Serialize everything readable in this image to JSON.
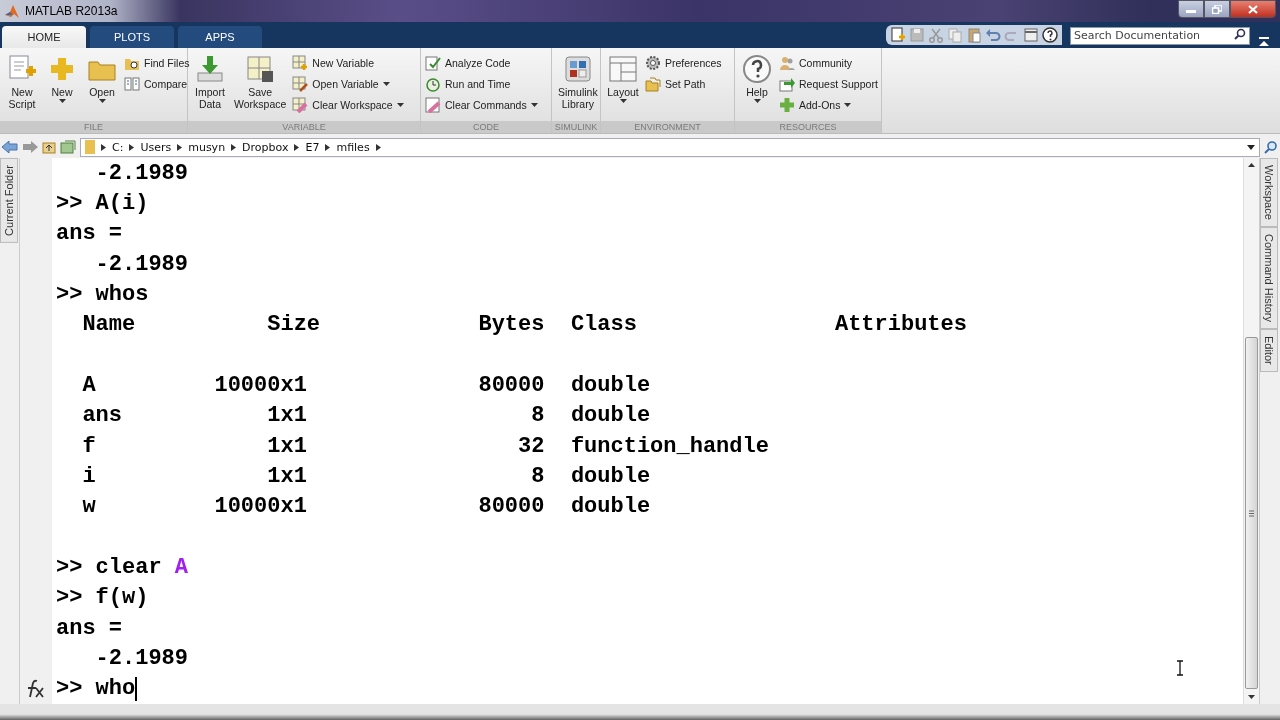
{
  "window": {
    "title": "MATLAB R2013a"
  },
  "tabs": [
    {
      "label": "HOME",
      "selected": true
    },
    {
      "label": "PLOTS",
      "selected": false
    },
    {
      "label": "APPS",
      "selected": false
    }
  ],
  "search": {
    "placeholder": "Search Documentation"
  },
  "toolstrip": {
    "sections": [
      {
        "label": "FILE",
        "items": [
          {
            "kind": "large",
            "label": "New\nScript",
            "dropdown": false
          },
          {
            "kind": "large",
            "label": "New",
            "dropdown": true
          },
          {
            "kind": "large",
            "label": "Open",
            "dropdown": true
          },
          {
            "kind": "stack",
            "items": [
              {
                "label": "Find Files",
                "dropdown": false
              },
              {
                "label": "Compare",
                "dropdown": false
              }
            ]
          }
        ]
      },
      {
        "label": "VARIABLE",
        "items": [
          {
            "kind": "large",
            "label": "Import\nData",
            "dropdown": false
          },
          {
            "kind": "large",
            "label": "Save\nWorkspace",
            "dropdown": false
          },
          {
            "kind": "stack",
            "items": [
              {
                "label": "New Variable",
                "dropdown": false
              },
              {
                "label": "Open Variable",
                "dropdown": true
              },
              {
                "label": "Clear Workspace",
                "dropdown": true
              }
            ]
          }
        ]
      },
      {
        "label": "CODE",
        "items": [
          {
            "kind": "stack",
            "items": [
              {
                "label": "Analyze Code",
                "dropdown": false
              },
              {
                "label": "Run and Time",
                "dropdown": false
              },
              {
                "label": "Clear Commands",
                "dropdown": true
              }
            ]
          }
        ]
      },
      {
        "label": "SIMULINK",
        "items": [
          {
            "kind": "large",
            "label": "Simulink\nLibrary",
            "dropdown": false
          }
        ]
      },
      {
        "label": "ENVIRONMENT",
        "items": [
          {
            "kind": "large",
            "label": "Layout",
            "dropdown": true
          },
          {
            "kind": "stack",
            "items": [
              {
                "label": "Preferences",
                "dropdown": false
              },
              {
                "label": "Set Path",
                "dropdown": false
              }
            ]
          }
        ]
      },
      {
        "label": "RESOURCES",
        "items": [
          {
            "kind": "large",
            "label": "Help",
            "dropdown": true
          },
          {
            "kind": "stack",
            "items": [
              {
                "label": "Community",
                "dropdown": false
              },
              {
                "label": "Request Support",
                "dropdown": false
              },
              {
                "label": "Add-Ons",
                "dropdown": true
              }
            ]
          }
        ]
      }
    ]
  },
  "path": {
    "segments": [
      "C:",
      "Users",
      "musyn",
      "Dropbox",
      "E7",
      "mfiles"
    ]
  },
  "side_tabs": {
    "left": [
      "Current Folder"
    ],
    "right": [
      "Workspace",
      "Command History",
      "Editor"
    ]
  },
  "console": {
    "lines": [
      {
        "kind": "text",
        "text": "   -2.1989"
      },
      {
        "kind": "text",
        "text": ">> A(i)"
      },
      {
        "kind": "text",
        "text": "ans ="
      },
      {
        "kind": "text",
        "text": "   -2.1989"
      },
      {
        "kind": "text",
        "text": ">> whos"
      },
      {
        "kind": "text",
        "text": "  Name          Size            Bytes  Class               Attributes"
      },
      {
        "kind": "blank"
      },
      {
        "kind": "text",
        "text": "  A         10000x1             80000  double"
      },
      {
        "kind": "text",
        "text": "  ans           1x1                 8  double"
      },
      {
        "kind": "text",
        "text": "  f             1x1                32  function_handle"
      },
      {
        "kind": "text",
        "text": "  i             1x1                 8  double"
      },
      {
        "kind": "text",
        "text": "  w         10000x1             80000  double"
      },
      {
        "kind": "blank"
      },
      {
        "kind": "text",
        "text": ">> clear",
        "arg": "A"
      },
      {
        "kind": "text",
        "text": ">> f(w)"
      },
      {
        "kind": "text",
        "text": "ans ="
      },
      {
        "kind": "text",
        "text": "   -2.1989"
      },
      {
        "kind": "input",
        "text": ">> who"
      }
    ]
  }
}
